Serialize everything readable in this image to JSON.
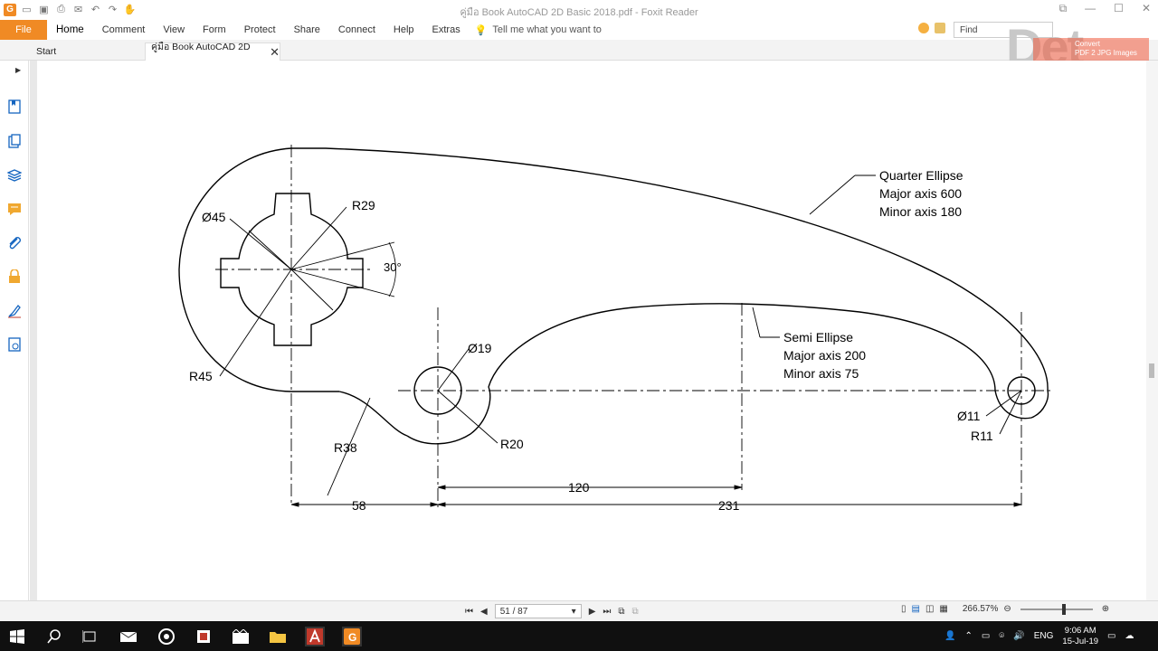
{
  "window": {
    "title": "คู่มือ Book AutoCAD 2D Basic 2018.pdf - Foxit Reader",
    "logo_letter": "G",
    "icons": [
      "open-icon",
      "save-icon",
      "print-icon",
      "undo-icon",
      "redo-icon",
      "hand-tool-icon"
    ],
    "controls": [
      "restore-icon",
      "minimize-icon",
      "maximize-icon",
      "close-icon"
    ]
  },
  "menu": {
    "file": "File",
    "items": [
      "Home",
      "Comment",
      "View",
      "Form",
      "Protect",
      "Share",
      "Connect",
      "Help",
      "Extras"
    ],
    "tell_me": "Tell me what you want to",
    "find_placeholder": "Find"
  },
  "tabs": {
    "start": "Start",
    "document": "คู่มือ Book AutoCAD 2D ..."
  },
  "watermark": {
    "brand": "Det",
    "convert": "Convert",
    "convert_sub": "PDF 2 JPG Images"
  },
  "sidebar": {
    "icons": [
      "bookmarks-icon",
      "pages-icon",
      "layers-icon",
      "comments-icon",
      "attachments-icon",
      "security-icon",
      "signature-icon",
      "content-icon"
    ]
  },
  "drawing": {
    "labels": {
      "quarter_title": "Quarter Ellipse",
      "quarter_major": "Major axis 600",
      "quarter_minor": "Minor axis 180",
      "semi_title": "Semi Ellipse",
      "semi_major": "Major axis 200",
      "semi_minor": "Minor axis 75",
      "d45": "Ø45",
      "r29": "R29",
      "angle": "30°",
      "r45": "R45",
      "d19": "Ø19",
      "r38": "R38",
      "r20": "R20",
      "d11": "Ø11",
      "r11": "R11",
      "dim58": "58",
      "dim120": "120",
      "dim231": "231"
    }
  },
  "status": {
    "page": "51 / 87",
    "zoom": "266.57%"
  },
  "taskbar": {
    "lang": "ENG",
    "time": "9:06 AM",
    "date": "15-Jul-19"
  }
}
